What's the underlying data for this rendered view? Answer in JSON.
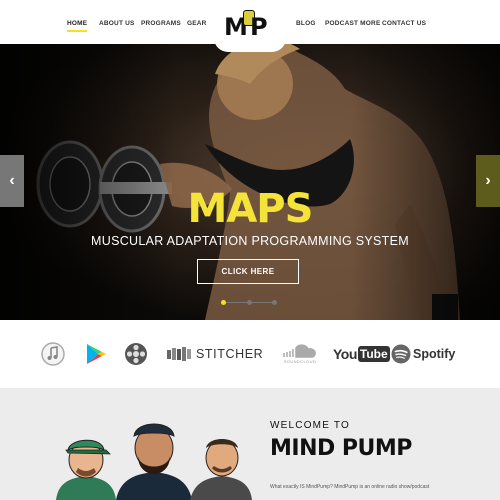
{
  "nav": {
    "left_items": [
      {
        "label": "HOME",
        "active": true
      },
      {
        "label": "ABOUT US",
        "active": false
      },
      {
        "label": "PROGRAMS",
        "active": false
      },
      {
        "label": "GEAR",
        "active": false
      }
    ],
    "right_items": [
      {
        "label": "BLOG",
        "active": false
      },
      {
        "label": "PODCAST MORE",
        "active": false
      },
      {
        "label": "CONTACT US",
        "active": false
      }
    ],
    "accent_color": "#f2e21f",
    "logo_text": "MP"
  },
  "hero": {
    "title": "MAPS",
    "subtitle": "MUSCULAR ADAPTATION PROGRAMMING SYSTEM",
    "cta_label": "CLICK HERE",
    "title_color": "#f4e43a",
    "prev_icon": "chevron-left-icon",
    "next_icon": "chevron-right-icon",
    "slide_count": 3,
    "active_slide": 1
  },
  "platforms": {
    "items": [
      {
        "name": "itunes-icon"
      },
      {
        "name": "google-play-icon"
      },
      {
        "name": "film-reel-icon"
      },
      {
        "name": "stitcher-icon",
        "label": "STITCHER"
      },
      {
        "name": "soundcloud-icon",
        "label": "SOUNDCLOUD"
      },
      {
        "name": "youtube-icon",
        "label": "YouTube"
      },
      {
        "name": "spotify-icon",
        "label": "Spotify"
      }
    ]
  },
  "welcome": {
    "heading_small": "WELCOME TO",
    "heading_big": "MIND PUMP",
    "body": "What exactly IS MindPump? MindPump is an online radio show/podcast"
  }
}
